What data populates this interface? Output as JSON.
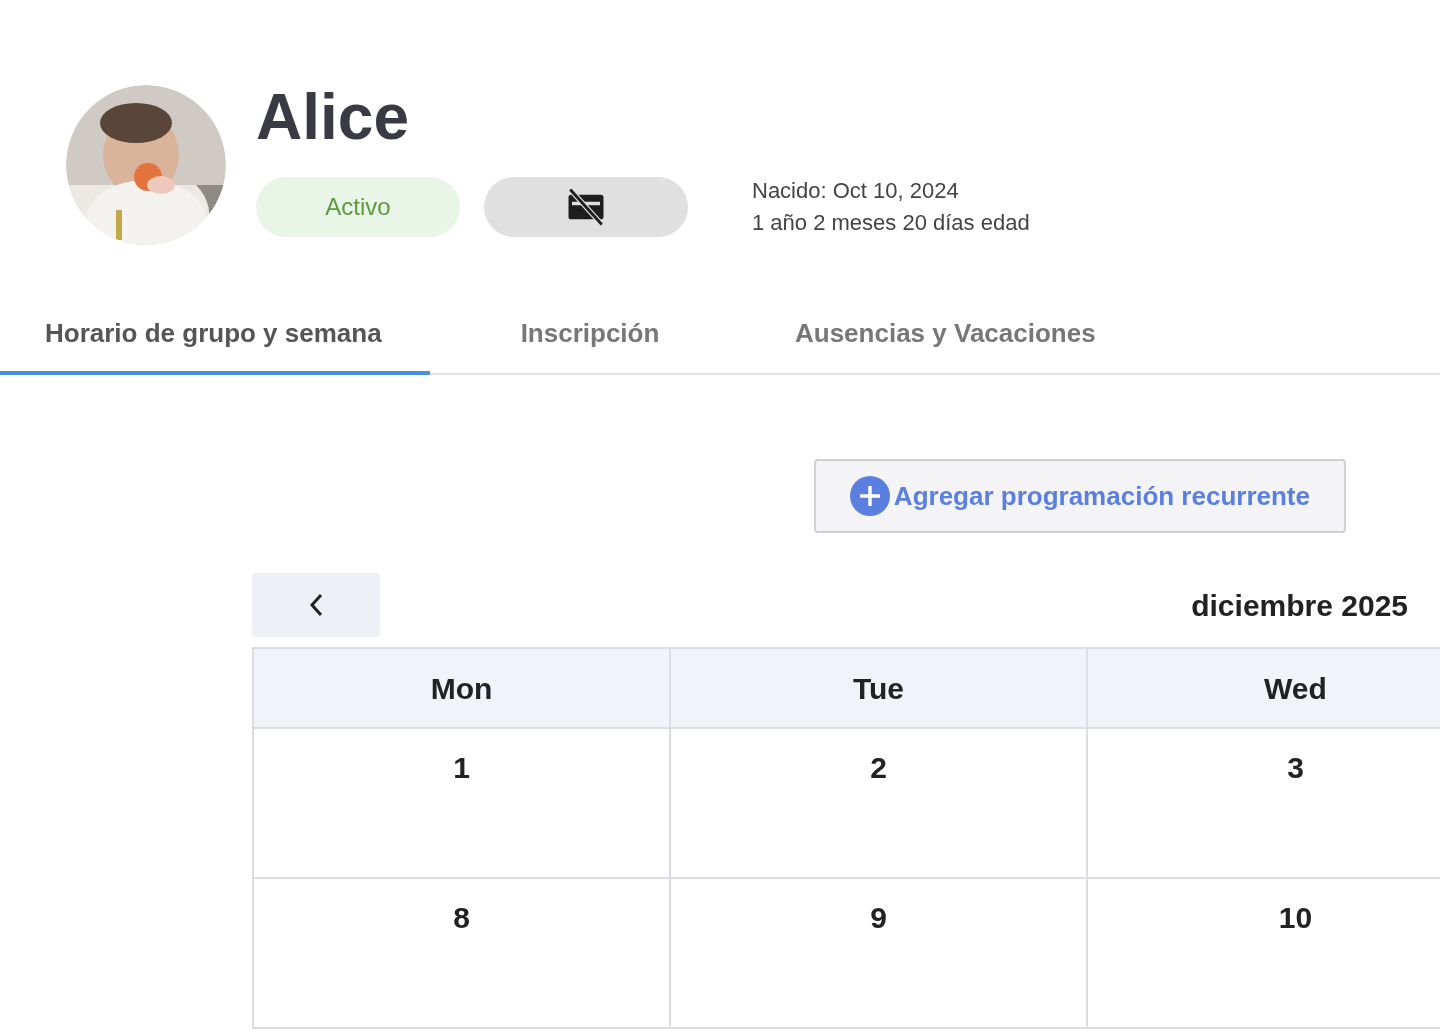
{
  "profile": {
    "name": "Alice",
    "status": "Activo",
    "born": "Nacido: Oct 10, 2024",
    "age": "1 año 2 meses 20 días edad"
  },
  "tabs": [
    {
      "label": "Horario de grupo y semana",
      "selected": true
    },
    {
      "label": "Inscripción",
      "selected": false
    },
    {
      "label": "Ausencias y Vacaciones",
      "selected": false
    }
  ],
  "add_button": "Agregar programación recurrente",
  "calendar": {
    "month": "diciembre 2025",
    "weekdays": [
      "Mon",
      "Tue",
      "Wed"
    ],
    "weeks": [
      [
        "1",
        "2",
        "3"
      ],
      [
        "8",
        "9",
        "10"
      ]
    ]
  }
}
